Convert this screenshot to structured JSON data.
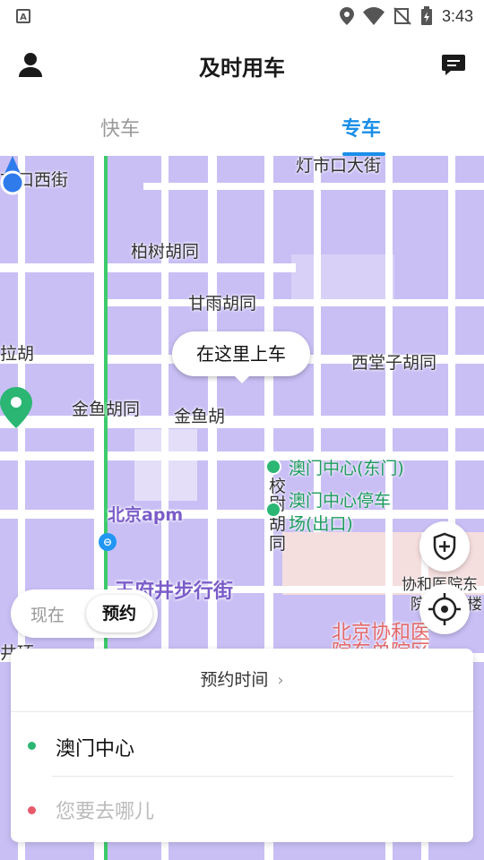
{
  "status_bar": {
    "time": "3:43"
  },
  "header": {
    "title": "及时用车"
  },
  "tabs": [
    {
      "label": "快车"
    },
    {
      "label": "专车"
    }
  ],
  "map": {
    "labels": {
      "l1": "市口西街",
      "l2": "灯市口大街",
      "l3": "柏树胡同",
      "l4": "甘雨胡同",
      "l5": "拉胡",
      "l6": "西堂子胡同",
      "l7": "金鱼胡同",
      "l8": "金鱼胡",
      "l9": "澳门中心(东门)",
      "l10": "澳门中心停车",
      "l11": "场(出口)",
      "l12": "校",
      "l13": "尉",
      "l14": "胡",
      "l15": "同",
      "l16": "北京apm",
      "l17": "王府井步行街",
      "l18": "协和医院东",
      "l19": "院",
      "l20": "诊楼",
      "l21": "北京协和医",
      "l22": "院东单院区",
      "l23": "井环"
    },
    "pickup_bubble": "在这里上车"
  },
  "time_toggle": {
    "now": "现在",
    "reserve": "预约"
  },
  "panel": {
    "reserve_time": "预约时间",
    "from": "澳门中心",
    "to_placeholder": "您要去哪儿"
  },
  "colors": {
    "accent": "#1a8fe8",
    "map_bg": "#c9bff5",
    "green": "#2bb673",
    "red": "#e85a6a"
  }
}
